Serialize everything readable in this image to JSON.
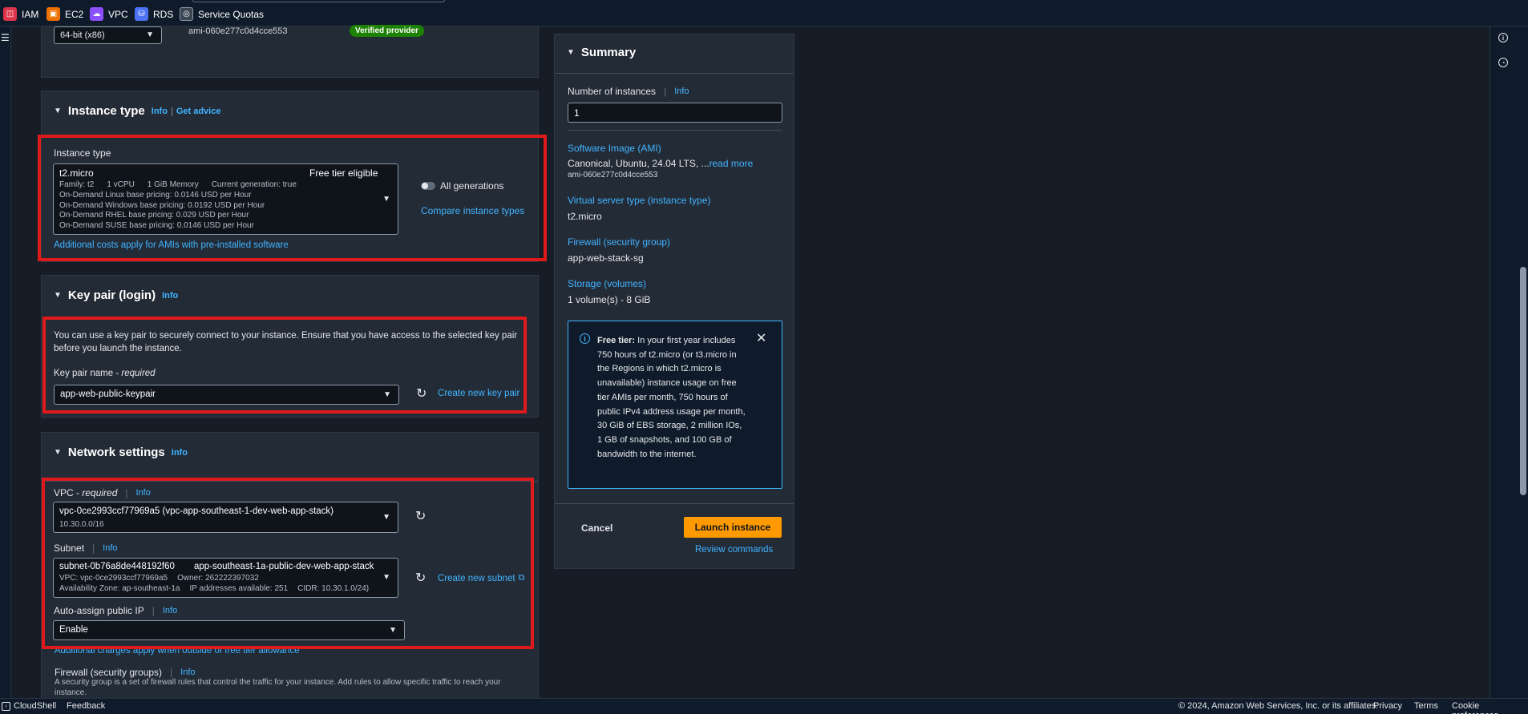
{
  "topbar": {
    "services": [
      {
        "label": "IAM",
        "icon": "iam-icon",
        "color": "#dd344c"
      },
      {
        "label": "EC2",
        "icon": "ec2-icon",
        "color": "#ed7100"
      },
      {
        "label": "VPC",
        "icon": "vpc-icon",
        "color": "#8c4fff"
      },
      {
        "label": "RDS",
        "icon": "rds-icon",
        "color": "#4d72f3"
      },
      {
        "label": "Service Quotas",
        "icon": "service-quotas-icon",
        "color": "#5f6b7a"
      }
    ]
  },
  "ami": {
    "architecture": "64-bit (x86)",
    "ami_id": "ami-060e277c0d4cce553",
    "badge": "Verified provider"
  },
  "instance_type": {
    "title": "Instance type",
    "info": "Info",
    "separator": "|",
    "get_advice": "Get advice",
    "field_label": "Instance type",
    "selected": "t2.micro",
    "free_tier": "Free tier eligible",
    "family": "Family: t2",
    "vcpu": "1 vCPU",
    "memory": "1 GiB Memory",
    "generation": "Current generation: true",
    "pricing": [
      "On-Demand Linux base pricing: 0.0146 USD per Hour",
      "On-Demand Windows base pricing: 0.0192 USD per Hour",
      "On-Demand RHEL base pricing: 0.029 USD per Hour",
      "On-Demand SUSE base pricing: 0.0146 USD per Hour"
    ],
    "all_generations": "All generations",
    "compare": "Compare instance types",
    "additional_costs": "Additional costs apply for AMIs with pre-installed software"
  },
  "key_pair": {
    "title": "Key pair (login)",
    "info": "Info",
    "description": "You can use a key pair to securely connect to your instance. Ensure that you have access to the selected key pair before you launch the instance.",
    "name_label": "Key pair name - ",
    "required": "required",
    "selected": "app-web-public-keypair",
    "create": "Create new key pair"
  },
  "network": {
    "title": "Network settings",
    "info": "Info",
    "vpc_label": "VPC - ",
    "required": "required",
    "vpc_info": "Info",
    "vpc_value": "vpc-0ce2993ccf77969a5 (vpc-app-southeast-1-dev-web-app-stack)",
    "vpc_cidr": "10.30.0.0/16",
    "subnet_label": "Subnet",
    "subnet_info": "Info",
    "subnet_id": "subnet-0b76a8de448192f60",
    "subnet_name": "app-southeast-1a-public-dev-web-app-stack",
    "subnet_vpc": "VPC: vpc-0ce2993ccf77969a5",
    "subnet_owner": "Owner: 262222397032",
    "subnet_az": "Availability Zone: ap-southeast-1a",
    "subnet_ips": "IP addresses available: 251",
    "subnet_cidr": "CIDR: 10.30.1.0/24)",
    "create_subnet": "Create new subnet",
    "auto_ip_label": "Auto-assign public IP",
    "auto_ip_info": "Info",
    "auto_ip_value": "Enable",
    "additional_charges": "Additional charges apply when outside of free tier allowance",
    "firewall_label": "Firewall (security groups)",
    "firewall_info": "Info",
    "firewall_desc": "A security group is a set of firewall rules that control the traffic for your instance. Add rules to allow specific traffic to reach your instance."
  },
  "summary": {
    "title": "Summary",
    "num_label": "Number of instances",
    "num_info": "Info",
    "num_value": "1",
    "ami_label": "Software Image (AMI)",
    "ami_value": "Canonical, Ubuntu, 24.04 LTS, ...",
    "read_more": "read more",
    "ami_id": "ami-060e277c0d4cce553",
    "type_label": "Virtual server type (instance type)",
    "type_value": "t2.micro",
    "firewall_label": "Firewall (security group)",
    "firewall_value": "app-web-stack-sg",
    "storage_label": "Storage (volumes)",
    "storage_value": "1 volume(s) - 8 GiB",
    "free_tier_bold": "Free tier:",
    "free_tier_text": " In your first year includes 750 hours of t2.micro (or t3.micro in the Regions in which t2.micro is unavailable) instance usage on free tier AMIs per month, 750 hours of public IPv4 address usage per month, 30 GiB of EBS storage, 2 million IOs, 1 GB of snapshots, and 100 GB of bandwidth to the internet.",
    "cancel": "Cancel",
    "launch": "Launch instance",
    "review": "Review commands"
  },
  "footer": {
    "cloudshell": "CloudShell",
    "feedback": "Feedback",
    "copyright": "© 2024, Amazon Web Services, Inc. or its affiliates.",
    "privacy": "Privacy",
    "terms": "Terms",
    "cookies": "Cookie preferences"
  },
  "colors": {
    "accent": "#42b4ff",
    "orange": "#ff9900",
    "highlight": "#e0191b",
    "verified": "#1d8102"
  }
}
